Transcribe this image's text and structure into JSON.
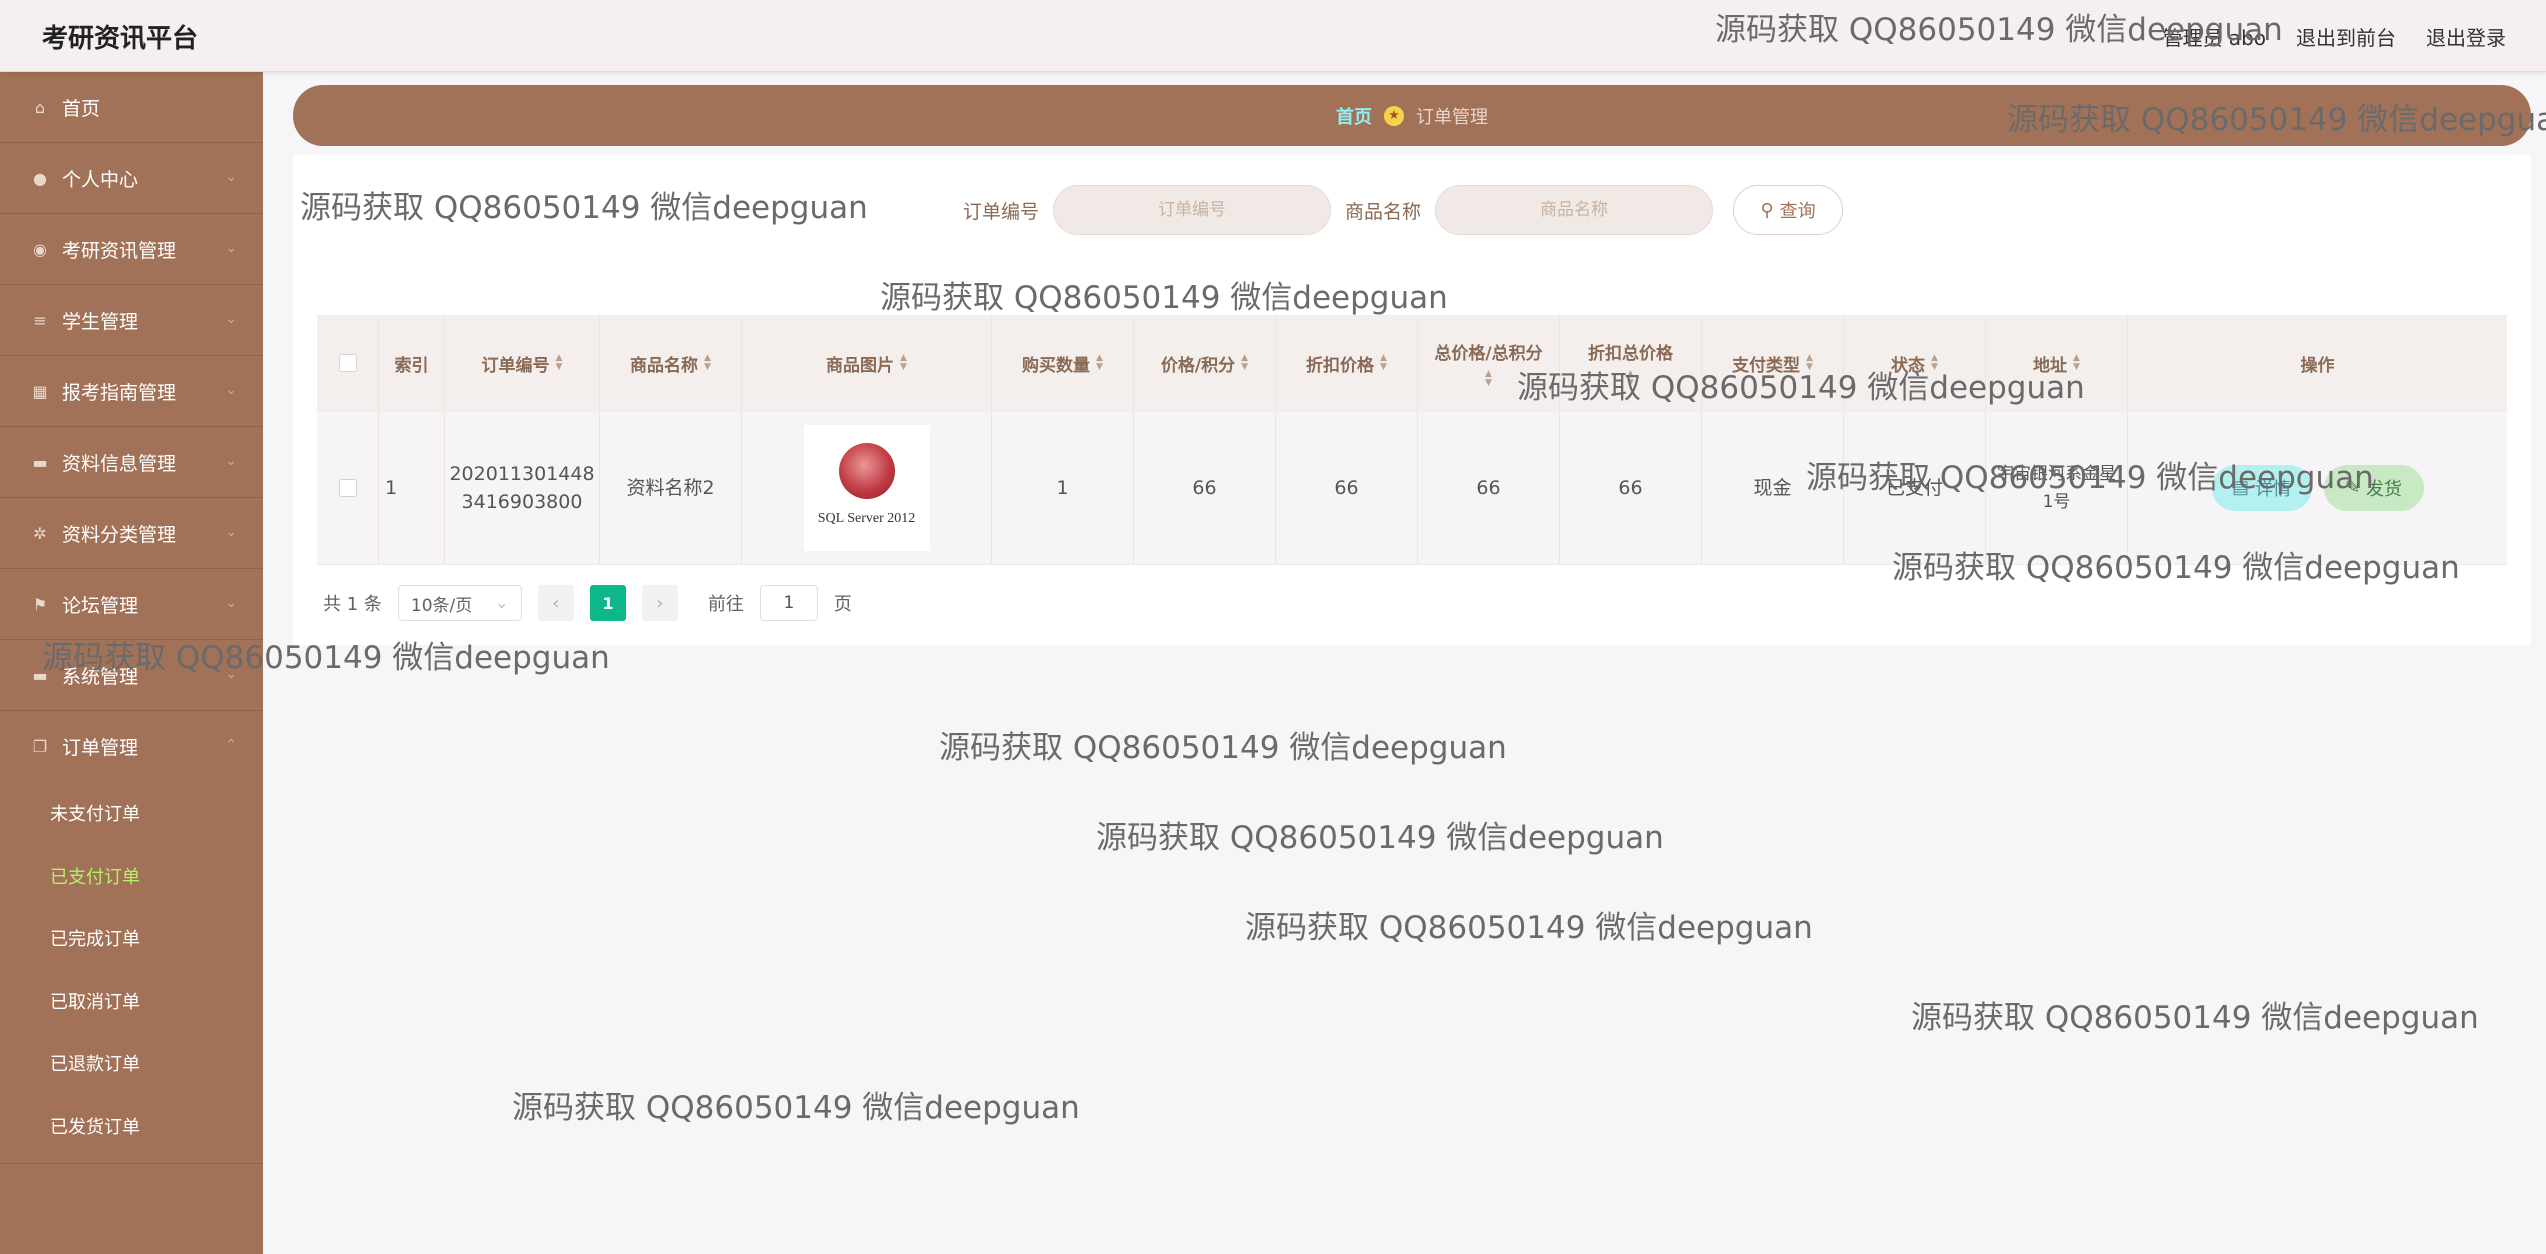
{
  "app": {
    "title": "考研资讯平台"
  },
  "header": {
    "user_label": "管理员 abo",
    "to_front": "退出到前台",
    "logout": "退出登录"
  },
  "sidebar": {
    "items": [
      {
        "label": "首页",
        "icon": "home-icon",
        "glyph": "⌂"
      },
      {
        "label": "个人中心",
        "icon": "user-icon",
        "glyph": "●"
      },
      {
        "label": "考研资讯管理",
        "icon": "microphone-icon",
        "glyph": "◉"
      },
      {
        "label": "学生管理",
        "icon": "list-icon",
        "glyph": "≡"
      },
      {
        "label": "报考指南管理",
        "icon": "grid-icon",
        "glyph": "▦"
      },
      {
        "label": "资料信息管理",
        "icon": "briefcase-icon",
        "glyph": "▬"
      },
      {
        "label": "资料分类管理",
        "icon": "settings-icon",
        "glyph": "✲"
      },
      {
        "label": "论坛管理",
        "icon": "flag-icon",
        "glyph": "⚑"
      },
      {
        "label": "系统管理",
        "icon": "suitcase-icon",
        "glyph": "▬"
      },
      {
        "label": "订单管理",
        "icon": "copy-icon",
        "glyph": "❐"
      }
    ],
    "order_submenu": [
      "未支付订单",
      "已支付订单",
      "已完成订单",
      "已取消订单",
      "已退款订单",
      "已发货订单"
    ],
    "active_sub": "已支付订单"
  },
  "breadcrumb": {
    "home": "首页",
    "current": "订单管理"
  },
  "search": {
    "order_no_label": "订单编号",
    "order_no_placeholder": "订单编号",
    "product_label": "商品名称",
    "product_placeholder": "商品名称",
    "query_button": "查询"
  },
  "table": {
    "headers": [
      "索引",
      "订单编号",
      "商品名称",
      "商品图片",
      "购买数量",
      "价格/积分",
      "折扣价格",
      "总价格/总积分",
      "折扣总价格",
      "支付类型",
      "状态",
      "地址",
      "操作"
    ],
    "rows": [
      {
        "index": "1",
        "order_no": "2020113014483416903800",
        "order_no_line1": "202011301448",
        "order_no_line2": "3416903800",
        "product": "资料名称2",
        "image_caption": "SQL Server 2012",
        "quantity": "1",
        "price": "66",
        "discount_price": "66",
        "total": "66",
        "discount_total": "66",
        "pay_type": "现金",
        "status": "已支付",
        "address": "宇宙银河系金星1号",
        "detail_button": "详情",
        "ship_button": "发货"
      }
    ]
  },
  "pagination": {
    "total": "共 1 条",
    "page_size": "10条/页",
    "current": "1",
    "goto_label": "前往",
    "goto_value": "1",
    "page_suffix": "页"
  },
  "watermark": "源码获取 QQ86050149 微信deepguan"
}
